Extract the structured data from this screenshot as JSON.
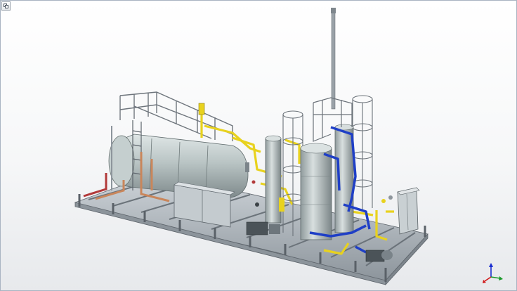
{
  "viewport": {
    "background_top": "#ffffff",
    "background_bottom": "#e7e9ec",
    "border_color": "#a9b4c2"
  },
  "controls": {
    "corner_button_icon": "view-restore-icon"
  },
  "model": {
    "vessel_color": "#b9c4c4",
    "frame_color": "#aeb5bc",
    "pipe_yellow": "#e8d21e",
    "pipe_blue": "#1f3fc6",
    "pipe_copper": "#c9865b",
    "pipe_red": "#b23a3a"
  },
  "triad": {
    "x_color": "#d01818",
    "y_color": "#1a9a2a",
    "z_color": "#1a2ed0",
    "icon": "axis-triad-icon"
  }
}
